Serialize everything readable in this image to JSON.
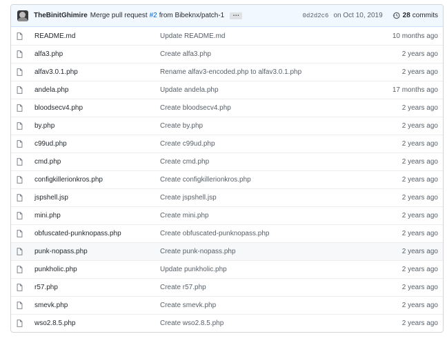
{
  "commit": {
    "author": "TheBinitGhimire",
    "message_prefix": "Merge pull request",
    "pr_link": "#2",
    "message_suffix": "from Bibeknx/patch-1",
    "ellipsis": "…",
    "sha": "0d2d2c6",
    "date": "on Oct 10, 2019",
    "commit_count": "28",
    "commits_label": "commits"
  },
  "files": [
    {
      "name": "README.md",
      "message": "Update README.md",
      "age": "10 months ago"
    },
    {
      "name": "alfa3.php",
      "message": "Create alfa3.php",
      "age": "2 years ago"
    },
    {
      "name": "alfav3.0.1.php",
      "message": "Rename alfav3-encoded.php to alfav3.0.1.php",
      "age": "2 years ago"
    },
    {
      "name": "andela.php",
      "message": "Update andela.php",
      "age": "17 months ago"
    },
    {
      "name": "bloodsecv4.php",
      "message": "Create bloodsecv4.php",
      "age": "2 years ago"
    },
    {
      "name": "by.php",
      "message": "Create by.php",
      "age": "2 years ago"
    },
    {
      "name": "c99ud.php",
      "message": "Create c99ud.php",
      "age": "2 years ago"
    },
    {
      "name": "cmd.php",
      "message": "Create cmd.php",
      "age": "2 years ago"
    },
    {
      "name": "configkillerionkros.php",
      "message": "Create configkillerionkros.php",
      "age": "2 years ago"
    },
    {
      "name": "jspshell.jsp",
      "message": "Create jspshell.jsp",
      "age": "2 years ago"
    },
    {
      "name": "mini.php",
      "message": "Create mini.php",
      "age": "2 years ago"
    },
    {
      "name": "obfuscated-punknopass.php",
      "message": "Create obfuscated-punknopass.php",
      "age": "2 years ago"
    },
    {
      "name": "punk-nopass.php",
      "message": "Create punk-nopass.php",
      "age": "2 years ago",
      "highlighted": true
    },
    {
      "name": "punkholic.php",
      "message": "Update punkholic.php",
      "age": "2 years ago"
    },
    {
      "name": "r57.php",
      "message": "Create r57.php",
      "age": "2 years ago"
    },
    {
      "name": "smevk.php",
      "message": "Create smevk.php",
      "age": "2 years ago"
    },
    {
      "name": "wso2.8.5.php",
      "message": "Create wso2.8.5.php",
      "age": "2 years ago"
    }
  ],
  "icons": {
    "file": "file-icon",
    "history": "history-icon",
    "avatar": "avatar"
  },
  "colors": {
    "link": "#0366d6",
    "commit_bar_bg": "#f1f8ff",
    "muted_text": "#586069"
  }
}
